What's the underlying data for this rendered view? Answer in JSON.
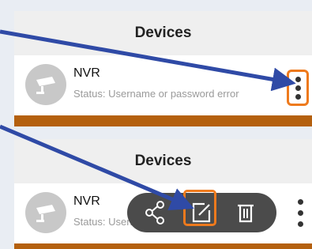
{
  "screen1": {
    "header_title": "Devices",
    "device": {
      "name": "NVR",
      "status": "Status: Username or password error"
    }
  },
  "screen2": {
    "header_title": "Devices",
    "device": {
      "name": "NVR",
      "status": "Status: Username or password error"
    },
    "actions": {
      "share": "share-icon",
      "edit": "edit-icon",
      "delete": "trash-icon"
    }
  },
  "colors": {
    "highlight": "#ee7a1d",
    "arrow": "#2f4aa6",
    "stripe": "#b4600e",
    "action_bar": "#4b4b4b"
  }
}
